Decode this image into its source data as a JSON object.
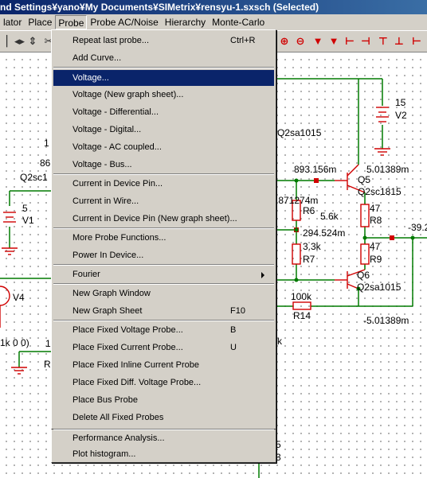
{
  "window": {
    "title": "nd Settings¥yano¥My Documents¥SIMetrix¥rensyu-1.sxsch (Selected)"
  },
  "menubar": {
    "items": [
      "lator",
      "Place",
      "Probe",
      "Probe AC/Noise",
      "Hierarchy",
      "Monte-Carlo"
    ]
  },
  "probe_menu": {
    "repeat_last_probe": "Repeat last probe...",
    "repeat_last_probe_shortcut": "Ctrl+R",
    "add_curve": "Add Curve...",
    "voltage": "Voltage...",
    "voltage_new_graph_sheet": "Voltage (New graph sheet)...",
    "voltage_differential": "Voltage - Differential...",
    "voltage_digital": "Voltage - Digital...",
    "voltage_ac_coupled": "Voltage - AC coupled...",
    "voltage_bus": "Voltage - Bus...",
    "current_in_device_pin": "Current in Device Pin...",
    "current_in_wire": "Current in Wire...",
    "current_in_device_pin_new_sheet": "Current in Device Pin (New graph sheet)...",
    "more_probe_functions": "More Probe Functions...",
    "power_in_device": "Power In Device...",
    "fourier": "Fourier",
    "new_graph_window": "New Graph Window",
    "new_graph_sheet": "New Graph Sheet",
    "new_graph_sheet_shortcut": "F10",
    "place_fixed_voltage_probe": "Place Fixed Voltage Probe...",
    "place_fixed_voltage_probe_shortcut": "B",
    "place_fixed_current_probe": "Place Fixed Current Probe...",
    "place_fixed_current_probe_shortcut": "U",
    "place_fixed_inline_current_probe": "Place Fixed Inline Current Probe",
    "place_fixed_diff_voltage_probe": "Place Fixed Diff. Voltage Probe...",
    "place_bus_probe": "Place Bus Probe",
    "delete_all_fixed_probes": "Delete All Fixed Probes",
    "performance_analysis": "Performance Analysis...",
    "plot_histogram": "Plot histogram..."
  },
  "schematic": {
    "labels": {
      "l_15": "15",
      "v2": "V2",
      "q2sa1015_top": "Q2sa1015",
      "l_1_a": "1",
      "l_86": "86",
      "q2sc1_left": "Q2sc1",
      "v_893": "893.156m",
      "q5": "Q5",
      "v_5013_top": "5.01389m",
      "q2sc1815": "Q2sc1815",
      "v_871": ".871274m",
      "r6": "R6",
      "l_5_6k": "5.6k",
      "l_47_a": "47",
      "r8": "R8",
      "v_39": "-39.2",
      "l_5": "5",
      "v1": "V1",
      "v_294": "294.524m",
      "l_3_3k": "3.3k",
      "l_47_b": "47",
      "r7": "R7",
      "r9": "R9",
      "q6": "Q6",
      "v4": "V4",
      "q2sa1015_bottom": "Q2sa1015",
      "l_100k": "100k",
      "r14": "R14",
      "v_5013_bottom": "-5.01389m",
      "l_1k00": "1k 0 0)",
      "l_1_b": "1",
      "l_k": "k",
      "l_r": "R",
      "l_5_b": "5",
      "l_3": "3"
    }
  },
  "colors": {
    "wire": "#007a00",
    "component": "#d00000",
    "selection": "#0a246a",
    "menu_bg": "#d4d0c8"
  }
}
